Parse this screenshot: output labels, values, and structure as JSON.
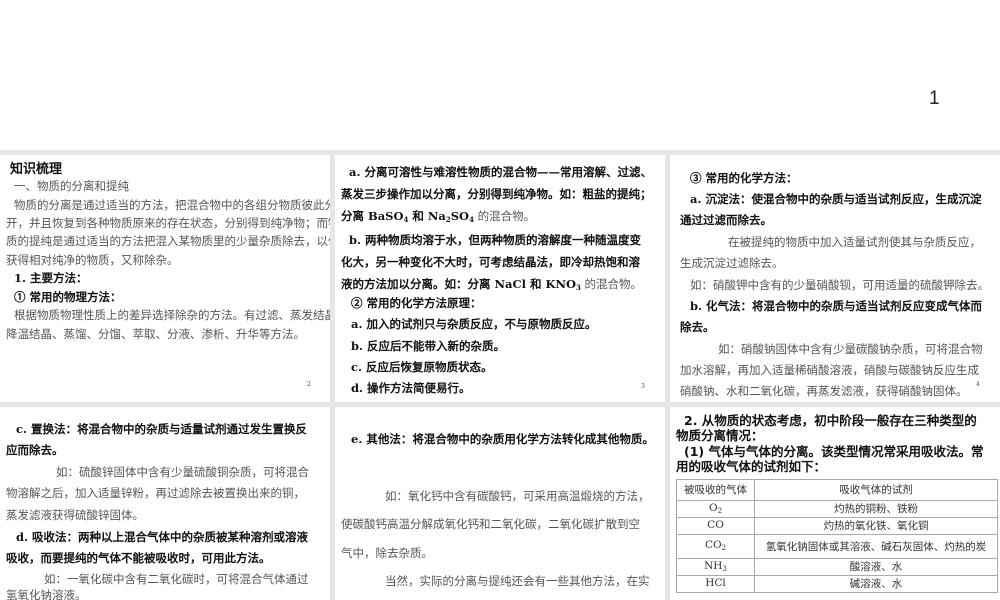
{
  "page_top": {
    "page_number": "1"
  },
  "slide2": {
    "title": "知识梳理",
    "lines": [
      "一、物质的分离和提纯",
      "物质的分离是通过适当的方法，把混合物中的各组分物质彼此分",
      "开，并且恢复到各种物质原来的存在状态，分别得到纯净物；而物",
      "质的提纯是通过适当的方法把混入某物质里的少量杂质除去，以便",
      "获得相对纯净的物质，又称除杂。",
      "1. 主要方法：",
      "① 常用的物理方法：",
      "根据物质物理性质上的差异选择除杂的方法。有过滤、蒸发结晶、",
      "降温结晶、蒸馏、分馏、萃取、分液、渗析、升华等方法。"
    ],
    "page": "2"
  },
  "slide3": {
    "lines": [
      "a. 分离可溶性与难溶性物质的混合物——常用溶解、过滤、",
      "蒸发三步操作加以分离，分别得到纯净物。如：粗盐的提纯；",
      "分离 BaSO",
      "4",
      " 和 Na",
      "2",
      "SO",
      "4",
      " 的混合物。",
      "b. 两种物质均溶于水，但两种物质的溶解度一种随温度变",
      "化大，另一种变化不大时，可考虑结晶法，即冷却热饱和溶",
      "液的方法加以分离。如：分离 NaCl 和 KNO",
      "3",
      " 的混合物。",
      "② 常用的化学方法原理：",
      "a. 加入的试剂只与杂质反应，不与原物质反应。",
      "b. 反应后不能带入新的杂质。",
      "c. 反应后恢复原物质状态。",
      "d. 操作方法简便易行。"
    ],
    "page": "3"
  },
  "slide4": {
    "lines": [
      "③ 常用的化学方法：",
      "a. 沉淀法：使混合物中的杂质与适当试剂反应，生成沉淀",
      "通过过滤而除去。",
      "在被提纯的物质中加入适量试剂使其与杂质反应，",
      "生成沉淀过滤除去。",
      "如：硝酸钾中含有的少量硝酸钡，可用适量的硫酸钾除去。",
      "b. 化气法：将混合物中的杂质与适当试剂反应变成气体而",
      "除去。",
      "如：硝酸钠固体中含有少量碳酸钠杂质，可将混合物",
      "加水溶解，再加入适量稀硝酸溶液，硝酸与碳酸钠反应生成",
      "硝酸钠、水和二氧化碳，再蒸发滤液，获得硝酸钠固体。"
    ],
    "page": "4"
  },
  "slide5": {
    "lines": [
      "c. 置换法：将混合物中的杂质与适量试剂通过发生置换反",
      "应而除去。",
      "如：硫酸锌固体中含有少量硫酸铜杂质，可将混合",
      "物溶解之后，加入适量锌粉，再过滤除去被置换出来的铜，",
      "蒸发滤液获得硫酸锌固体。",
      "d. 吸收法：两种以上混合气体中的杂质被某种溶剂或溶液",
      "吸收，而要提纯的气体不能被吸收时，可用此方法。",
      "如：一氧化碳中含有二氧化碳时，可将混合气体通过",
      "氢氧化钠溶液。"
    ]
  },
  "slide6": {
    "lines": [
      "e. 其他法：将混合物中的杂质用化学方法转化成其他物质。",
      "如：氧化钙中含有碳酸钙，可采用高温煅烧的方法，",
      "使碳酸钙高温分解成氧化钙和二氧化碳，二氧化碳扩散到空",
      "气中，除去杂质。",
      "当然，实际的分离与提纯还会有一些其他方法，在实"
    ]
  },
  "slide7": {
    "lines": [
      "2. 从物质的状态考虑，初中阶段一般存在三种类型的",
      "物质分离情况：",
      "(1) 气体与气体的分离。该类型情况常采用吸收法。常",
      "用的吸收气体的试剂如下："
    ],
    "table": {
      "headers": [
        "被吸收的气体",
        "吸收气体的试剂"
      ],
      "rows": [
        {
          "gas": "O",
          "sub": "2",
          "reagent": "灼热的铜粉、铁粉"
        },
        {
          "gas": "CO",
          "sub": "",
          "reagent": "灼热的氧化铁、氧化铜"
        },
        {
          "gas": "CO",
          "sub": "2",
          "reagent": "氢氧化钠固体或其溶液、碱石灰固体、灼热的炭"
        },
        {
          "gas": "NH",
          "sub": "3",
          "reagent": "酸溶液、水"
        },
        {
          "gas": "HCl",
          "sub": "",
          "reagent": "碱溶液、水"
        }
      ]
    }
  }
}
